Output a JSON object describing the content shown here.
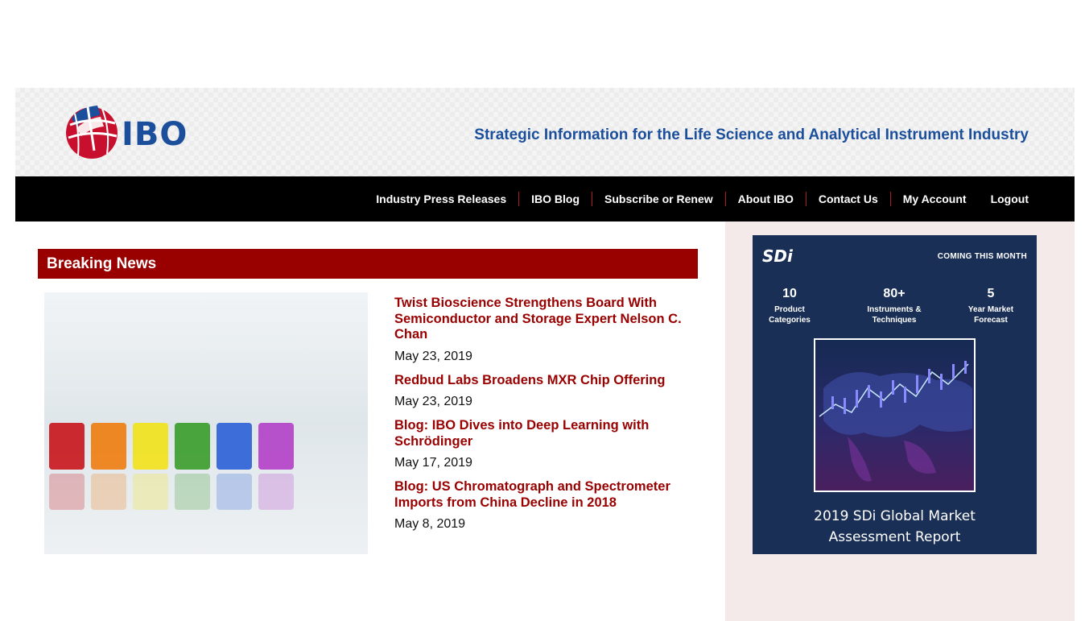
{
  "header": {
    "logo_text": "IBO",
    "tagline": "Strategic Information for the Life Science and Analytical Instrument Industry"
  },
  "nav": {
    "items": [
      {
        "label": "Industry Press Releases"
      },
      {
        "label": "IBO Blog"
      },
      {
        "label": "Subscribe or Renew"
      },
      {
        "label": "About IBO"
      },
      {
        "label": "Contact Us"
      },
      {
        "label": "My Account"
      },
      {
        "label": "Logout"
      }
    ]
  },
  "breaking_news": {
    "heading": "Breaking News",
    "items": [
      {
        "title": "Twist Bioscience Strengthens Board With Semiconductor and Storage Expert Nelson C. Chan",
        "date": "May 23, 2019"
      },
      {
        "title": "Redbud Labs Broadens MXR Chip Offering",
        "date": "May 23, 2019"
      },
      {
        "title": "Blog: IBO Dives into Deep Learning with Schrödinger",
        "date": "May 17, 2019"
      },
      {
        "title": "Blog: US Chromatograph and Spectrometer Imports from China Decline in 2018",
        "date": "May 8, 2019"
      }
    ]
  },
  "ad": {
    "logo": "SDi",
    "coming": "COMING THIS MONTH",
    "stats": [
      {
        "num": "10",
        "label": "Product\nCategories"
      },
      {
        "num": "80+",
        "label": "Instruments &\nTechniques"
      },
      {
        "num": "5",
        "label": "Year Market\nForecast"
      }
    ],
    "title": "2019 SDi Global Market\nAssessment Report"
  },
  "colors": {
    "brand_blue": "#1b4f9c",
    "brand_red": "#990000",
    "nav_bg": "#000000",
    "sidebar_bg": "#f4eaea",
    "ad_bg": "#1a2f55"
  }
}
